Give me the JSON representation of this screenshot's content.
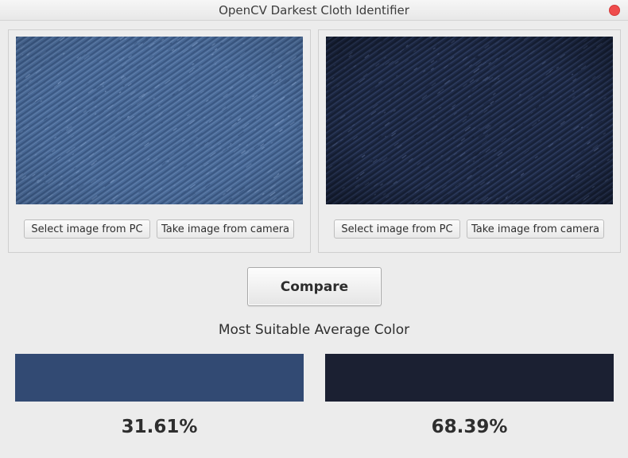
{
  "window": {
    "title": "OpenCV Darkest Cloth Identifier"
  },
  "icons": {
    "close": "close-icon"
  },
  "panels": [
    {
      "image": "light-denim-fabric-image",
      "texture_colors": {
        "base": "#4a6b99",
        "dark": "#35507a",
        "light": "#7d9ac4"
      },
      "select_label": "Select image from PC",
      "camera_label": "Take image from camera"
    },
    {
      "image": "dark-denim-fabric-image",
      "texture_colors": {
        "base": "#1e2a48",
        "dark": "#141c30",
        "light": "#4a5a80"
      },
      "select_label": "Select image from PC",
      "camera_label": "Take image from camera"
    }
  ],
  "compare_label": "Compare",
  "result": {
    "heading": "Most Suitable Average Color",
    "left": {
      "color": "#324a73",
      "percent": "31.61%"
    },
    "right": {
      "color": "#1b2032",
      "percent": "68.39%"
    }
  }
}
